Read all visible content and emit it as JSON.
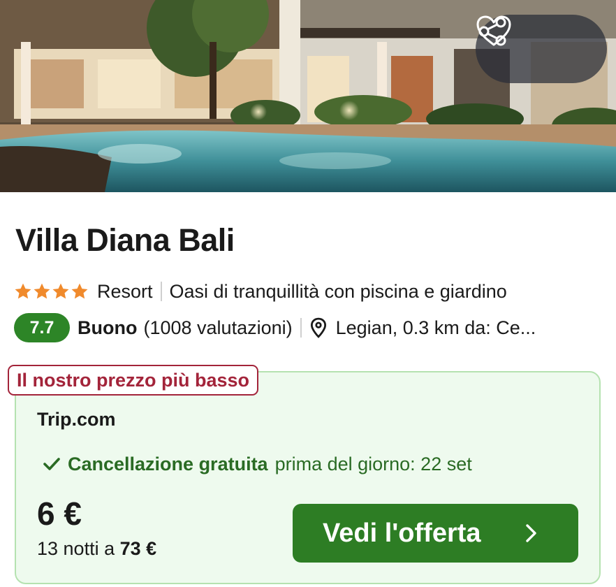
{
  "hotel": {
    "name": "Villa Diana Bali",
    "star_count": 4,
    "type": "Resort",
    "tagline": "Oasi di tranquillità con piscina e giardino",
    "score": "7.7",
    "rating_word": "Buono",
    "reviews": "(1008 valutazioni)",
    "location": "Legian, 0.3 km da: Ce..."
  },
  "hero": {
    "share_icon": "share-icon",
    "favorite_icon": "heart-icon"
  },
  "offer": {
    "badge": "Il nostro prezzo più basso",
    "provider": "Trip.com",
    "cancel_strong": "Cancellazione gratuita",
    "cancel_rest": "prima del giorno: 22 set",
    "price": "6 €",
    "nights_prefix": "13 notti a",
    "nights_total": "73 €",
    "cta_label": "Vedi l'offerta"
  },
  "colors": {
    "score_green": "#2d8527",
    "cta_green": "#2d7d24",
    "offer_bg": "#eefaee",
    "badge_red": "#a3243a",
    "star_orange": "#f08a2c"
  }
}
